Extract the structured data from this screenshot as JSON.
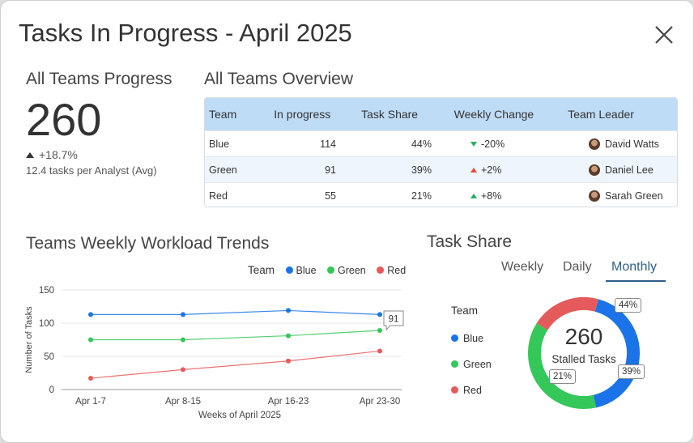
{
  "window": {
    "title": "Tasks In Progress - April 2025"
  },
  "progress": {
    "heading": "All Teams Progress",
    "total": "260",
    "change": "+18.7%",
    "avg": "12.4 tasks per Analyst (Avg)"
  },
  "overview": {
    "heading": "All Teams Overview",
    "columns": [
      "Team",
      "In progress",
      "Task Share",
      "Weekly Change",
      "Team Leader"
    ],
    "rows": [
      {
        "team": "Blue",
        "in_progress": "114",
        "share": "44%",
        "change": "-20%",
        "direction": "down",
        "change_color": "#27ae60",
        "leader": "David Watts"
      },
      {
        "team": "Green",
        "in_progress": "91",
        "share": "39%",
        "change": "+2%",
        "direction": "up",
        "change_color": "#e74c3c",
        "leader": "Daniel Lee"
      },
      {
        "team": "Red",
        "in_progress": "55",
        "share": "21%",
        "change": "+8%",
        "direction": "up",
        "change_color": "#27ae60",
        "leader": "Sarah Green"
      }
    ]
  },
  "trends": {
    "heading": "Teams Weekly Workload Trends",
    "legend_title": "Team",
    "chart_data": {
      "type": "line",
      "categories": [
        "Apr 1-7",
        "Apr 8-15",
        "Apr 16-23",
        "Apr 23-30"
      ],
      "series": [
        {
          "name": "Blue",
          "color": "#1a73e8",
          "values": [
            113,
            113,
            119,
            113
          ]
        },
        {
          "name": "Green",
          "color": "#34c759",
          "values": [
            75,
            75,
            81,
            89
          ]
        },
        {
          "name": "Red",
          "color": "#e55a5a",
          "values": [
            17,
            30,
            43,
            58
          ]
        }
      ],
      "xlabel": "Weeks of April 2025",
      "ylabel": "Number of Tasks",
      "ylim": [
        0,
        150
      ],
      "yticks": [
        "0",
        "50",
        "100",
        "150"
      ],
      "tooltip": "91",
      "grid": true,
      "legend": "top-right"
    }
  },
  "share": {
    "heading": "Task Share",
    "tabs": [
      "Weekly",
      "Daily",
      "Monthly"
    ],
    "active_tab": "Monthly",
    "legend_title": "Team",
    "center_value": "260",
    "center_label": "Stalled Tasks",
    "chart_data": {
      "type": "pie",
      "categories": [
        "Blue",
        "Green",
        "Red"
      ],
      "values": [
        44,
        39,
        21
      ],
      "labels": [
        "44%",
        "39%",
        "21%"
      ],
      "colors": [
        "#1a73e8",
        "#34c759",
        "#e55a5a"
      ]
    }
  }
}
